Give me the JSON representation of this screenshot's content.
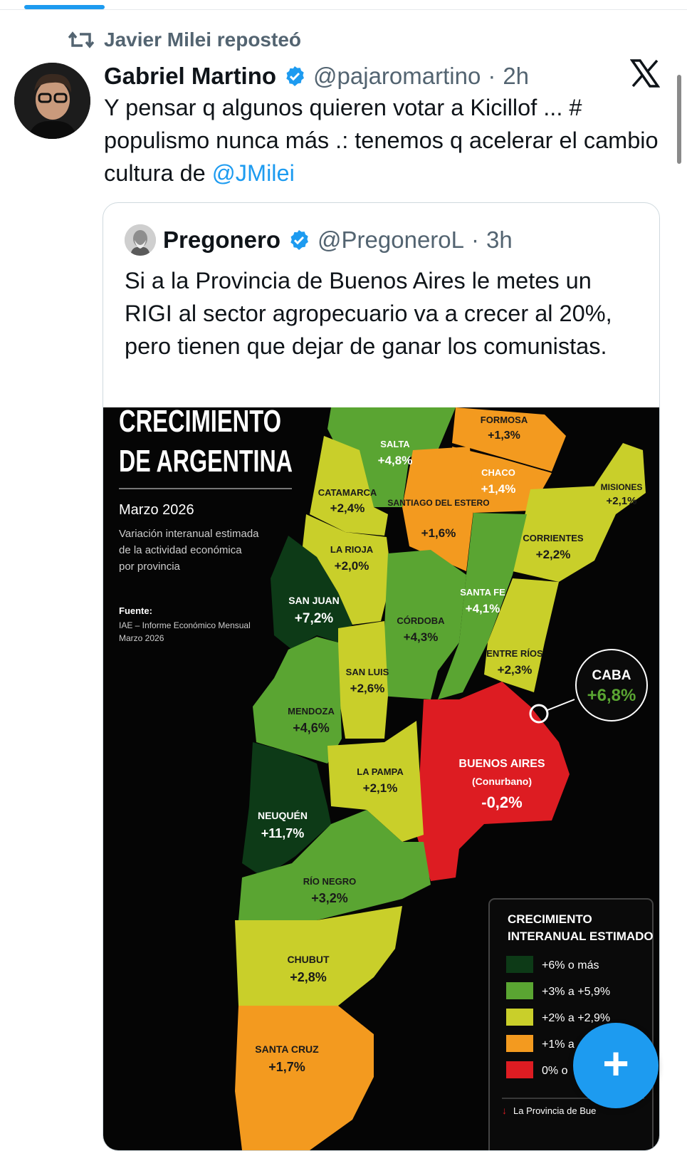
{
  "repost": {
    "label": "Javier Milei reposteó"
  },
  "tweet": {
    "name": "Gabriel Martino",
    "handle": "@pajaromartino",
    "sep": "·",
    "time": "2h",
    "text": "Y pensar q algunos quieren votar a Kicillof ... # populismo nunca más .: tenemos q acelerar el cambio cultura de ",
    "mention": "@JMilei"
  },
  "quote": {
    "name": "Pregonero",
    "handle": "@PregoneroL",
    "sep": "·",
    "time": "3h",
    "text": "Si a la Provincia de Buenos Aires le metes un RIGI al sector agropecuario va a crecer al 20%, pero tienen que dejar de ganar los comunistas."
  },
  "infographic": {
    "title_line1": "CRECIMIENTO",
    "title_line2": "DE ARGENTINA",
    "date": "Marzo 2026",
    "desc1": "Variación interanual estimada",
    "desc2": "de la actividad económica",
    "desc3": "por provincia",
    "source_label": "Fuente:",
    "source1": "IAE – Informe Económico Mensual",
    "source2": "Marzo 2026",
    "legend_title1": "CRECIMIENTO",
    "legend_title2": "INTERANUAL ESTIMADO",
    "legend": [
      "+6% o más",
      "+3% a +5,9%",
      "+2% a +2,9%",
      "+1% a",
      "0% o"
    ],
    "footnote": "La Provincia de Bue",
    "colors": {
      "dark_green": "#0d3a17",
      "green": "#5aa532",
      "yellow": "#c9cf2a",
      "orange": "#f39a1f",
      "red": "#dd1c22"
    },
    "regions": [
      {
        "name": "SALTA",
        "value": "+4,8%"
      },
      {
        "name": "FORMOSA",
        "value": "+1,3%"
      },
      {
        "name": "CHACO",
        "value": "+1,4%"
      },
      {
        "name": "MISIONES",
        "value": "+2,1%"
      },
      {
        "name": "CATAMARCA",
        "value": "+2,4%"
      },
      {
        "name": "SANTIAGO DEL ESTERO",
        "value": "+1,6%"
      },
      {
        "name": "CORRIENTES",
        "value": "+2,2%"
      },
      {
        "name": "LA RIOJA",
        "value": "+2,0%"
      },
      {
        "name": "SAN JUAN",
        "value": "+7,2%"
      },
      {
        "name": "CÓRDOBA",
        "value": "+4,3%"
      },
      {
        "name": "SANTA FE",
        "value": "+4,1%"
      },
      {
        "name": "ENTRE RÍOS",
        "value": "+2,3%"
      },
      {
        "name": "CABA",
        "value": "+6,8%"
      },
      {
        "name": "SAN LUIS",
        "value": "+2,6%"
      },
      {
        "name": "MENDOZA",
        "value": "+4,6%"
      },
      {
        "name": "BUENOS AIRES",
        "sub": "(Conurbano)",
        "value": "-0,2%"
      },
      {
        "name": "LA PAMPA",
        "value": "+2,1%"
      },
      {
        "name": "NEUQUÉN",
        "value": "+11,7%"
      },
      {
        "name": "RÍO NEGRO",
        "value": "+3,2%"
      },
      {
        "name": "CHUBUT",
        "value": "+2,8%"
      },
      {
        "name": "SANTA CRUZ",
        "value": "+1,7%"
      }
    ]
  },
  "fab": {
    "icon": "plus-icon"
  },
  "icons": {
    "repost": "repost-icon",
    "verified": "verified-badge-icon",
    "x": "x-logo-icon"
  }
}
